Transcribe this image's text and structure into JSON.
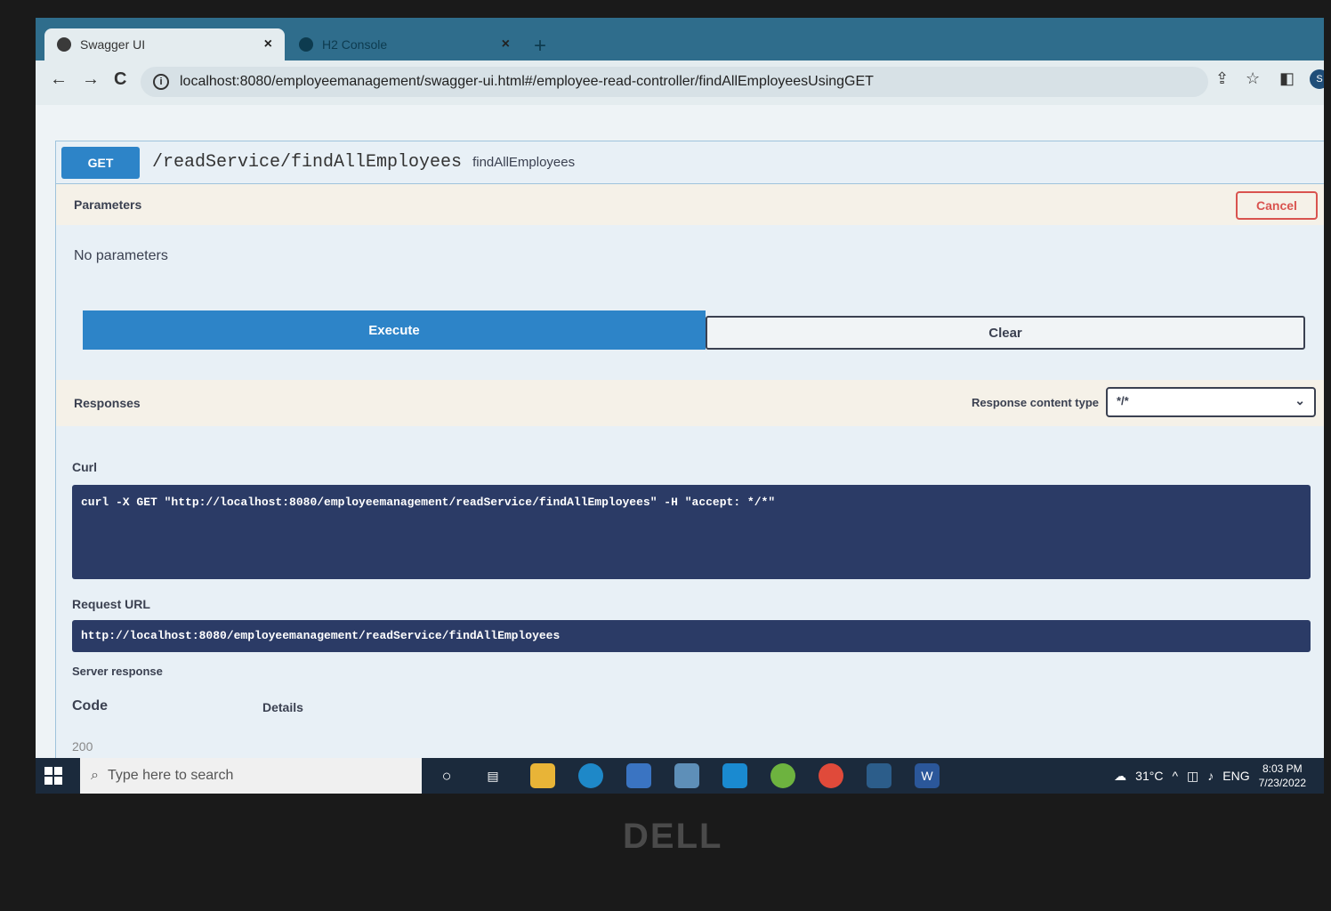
{
  "browser": {
    "tabs": [
      {
        "label": "Swagger UI"
      },
      {
        "label": "H2 Console"
      }
    ],
    "close_glyph": "×",
    "new_tab_glyph": "+",
    "nav": {
      "back": "←",
      "forward": "→",
      "reload": "C"
    },
    "url": "localhost:8080/employeemanagement/swagger-ui.html#/employee-read-controller/findAllEmployeesUsingGET",
    "avatar_letter": "S"
  },
  "operation": {
    "method": "GET",
    "path": "/readService/findAllEmployees",
    "description": "findAllEmployees"
  },
  "parameters": {
    "title": "Parameters",
    "cancel_label": "Cancel",
    "empty_text": "No parameters",
    "execute_label": "Execute",
    "clear_label": "Clear"
  },
  "responses": {
    "title": "Responses",
    "content_type_label": "Response content type",
    "content_type_value": "*/*",
    "curl_label": "Curl",
    "curl_command": "curl -X GET \"http://localhost:8080/employeemanagement/readService/findAllEmployees\" -H \"accept: */*\"",
    "request_url_label": "Request URL",
    "request_url": "http://localhost:8080/employeemanagement/readService/findAllEmployees",
    "server_response_label": "Server response",
    "code_header": "Code",
    "details_header": "Details",
    "code_value": "200"
  },
  "taskbar": {
    "search_placeholder": "Type here to search",
    "weather": "31°C",
    "language": "ENG",
    "time": "8:03 PM",
    "date": "7/23/2022"
  },
  "bezel": {
    "brand": "DELL"
  }
}
